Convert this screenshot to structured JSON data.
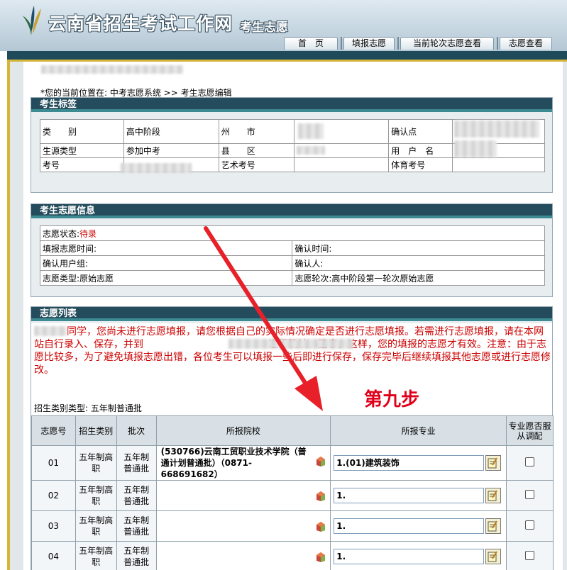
{
  "header": {
    "site_title": "云南省招生考试工作网",
    "site_sub": "考生志愿",
    "nav": [
      "首　页",
      "填报志愿",
      "当前轮次志愿查看",
      "志愿查看"
    ]
  },
  "breadcrumb": "*您的当前位置在: 中考志愿系统 >> 考生志愿编辑",
  "candidate": {
    "title": "考生标签",
    "label_category": "类　　别",
    "value_category": "高中阶段",
    "label_prefecture": "州　　市",
    "label_confirm_point": "确认点",
    "label_source_type": "生源类型",
    "value_source_type": "参加中考",
    "label_county": "县　　区",
    "label_username": "用　户　名",
    "label_exam_no": "考号",
    "label_art_no": "艺术考号",
    "label_pe_no": "体育考号"
  },
  "volunteer_info": {
    "title": "考生志愿信息",
    "status_label": "志愿状态:",
    "status_value": "待录",
    "fill_time": "填报志愿时间:",
    "confirm_time": "确认时间:",
    "confirm_group": "确认用户组:",
    "confirmer": "确认人:",
    "type": "志愿类型:原始志愿",
    "round": "志愿轮次:高中阶段第一轮次原始志愿"
  },
  "list": {
    "title": "志愿列表",
    "notice_1": "同学，您尚未进行志愿填报，请您根据自己的实际情况确定是否进行志愿填报。若需进行志愿填报，请在本网站自行录入、保存，并到",
    "notice_2": "进行确认、签字。这样，您的填报的志愿才有效。注意：由于志愿比较多，为了避免填报志愿出错，各位考生可以填报一些后即进行保存，保存完毕后继续填报其他志愿或进行志愿修改。",
    "category_type": "招生类别类型: 五年制普通批",
    "step_label": "第九步",
    "columns": [
      "志愿号",
      "招生类别",
      "批次",
      "所报院校",
      "所报专业",
      "专业愿否服从调配"
    ],
    "rows": [
      {
        "no": "01",
        "category": "五年制高职",
        "batch": "五年制普通批",
        "school": "(530766)云南工贸职业技术学院（普通计划普通批）（0871-668691682）",
        "major": "1.(01)建筑装饰"
      },
      {
        "no": "02",
        "category": "五年制高职",
        "batch": "五年制普通批",
        "school": "",
        "major": "1."
      },
      {
        "no": "03",
        "category": "五年制高职",
        "batch": "五年制普通批",
        "school": "",
        "major": "1."
      },
      {
        "no": "04",
        "category": "五年制高职",
        "batch": "五年制普通批",
        "school": "",
        "major": "1."
      }
    ]
  },
  "colors": {
    "panel_header": "#244c5c",
    "accent_gold": "#d6b53a",
    "notice_red": "#cc0000",
    "step_red": "#e0001b"
  }
}
